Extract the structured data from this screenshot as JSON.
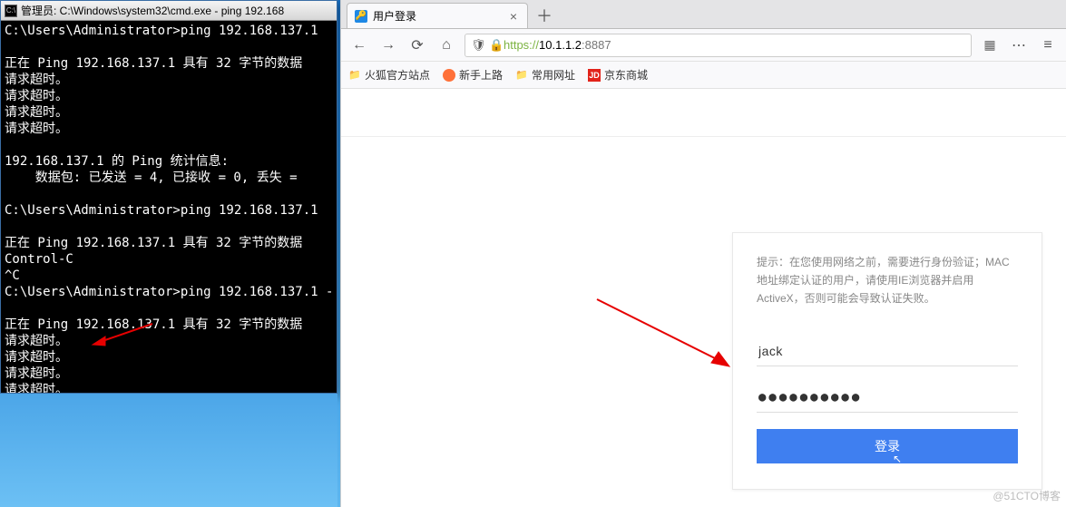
{
  "cmd": {
    "title": "管理员: C:\\Windows\\system32\\cmd.exe - ping  192.168",
    "icon_label": "C:\\",
    "lines": [
      "C:\\Users\\Administrator>ping 192.168.137.1",
      "",
      "正在 Ping 192.168.137.1 具有 32 字节的数据",
      "请求超时。",
      "请求超时。",
      "请求超时。",
      "请求超时。",
      "",
      "192.168.137.1 的 Ping 统计信息:",
      "    数据包: 已发送 = 4, 已接收 = 0, 丢失 =",
      "",
      "C:\\Users\\Administrator>ping 192.168.137.1",
      "",
      "正在 Ping 192.168.137.1 具有 32 字节的数据",
      "Control-C",
      "^C",
      "C:\\Users\\Administrator>ping 192.168.137.1 -",
      "",
      "正在 Ping 192.168.137.1 具有 32 字节的数据",
      "请求超时。",
      "请求超时。",
      "请求超时。",
      "请求超时。"
    ]
  },
  "browser": {
    "tab": {
      "title": "用户登录",
      "favicon_glyph": "🔑"
    },
    "address": {
      "protocol": "https://",
      "host": "10.1.1.2",
      "port": ":8887"
    },
    "bookmarks": {
      "b1": "火狐官方站点",
      "b2": "新手上路",
      "b3": "常用网址",
      "b4_icon": "JD",
      "b4": "京东商城"
    },
    "login": {
      "hint": "提示：在您使用网络之前，需要进行身份验证；MAC地址绑定认证的用户，请使用IE浏览器并启用ActiveX，否则可能会导致认证失败。",
      "username": "jack",
      "password_mask": "●●●●●●●●●●",
      "button": "登录"
    }
  },
  "watermark": "@51CTO博客"
}
